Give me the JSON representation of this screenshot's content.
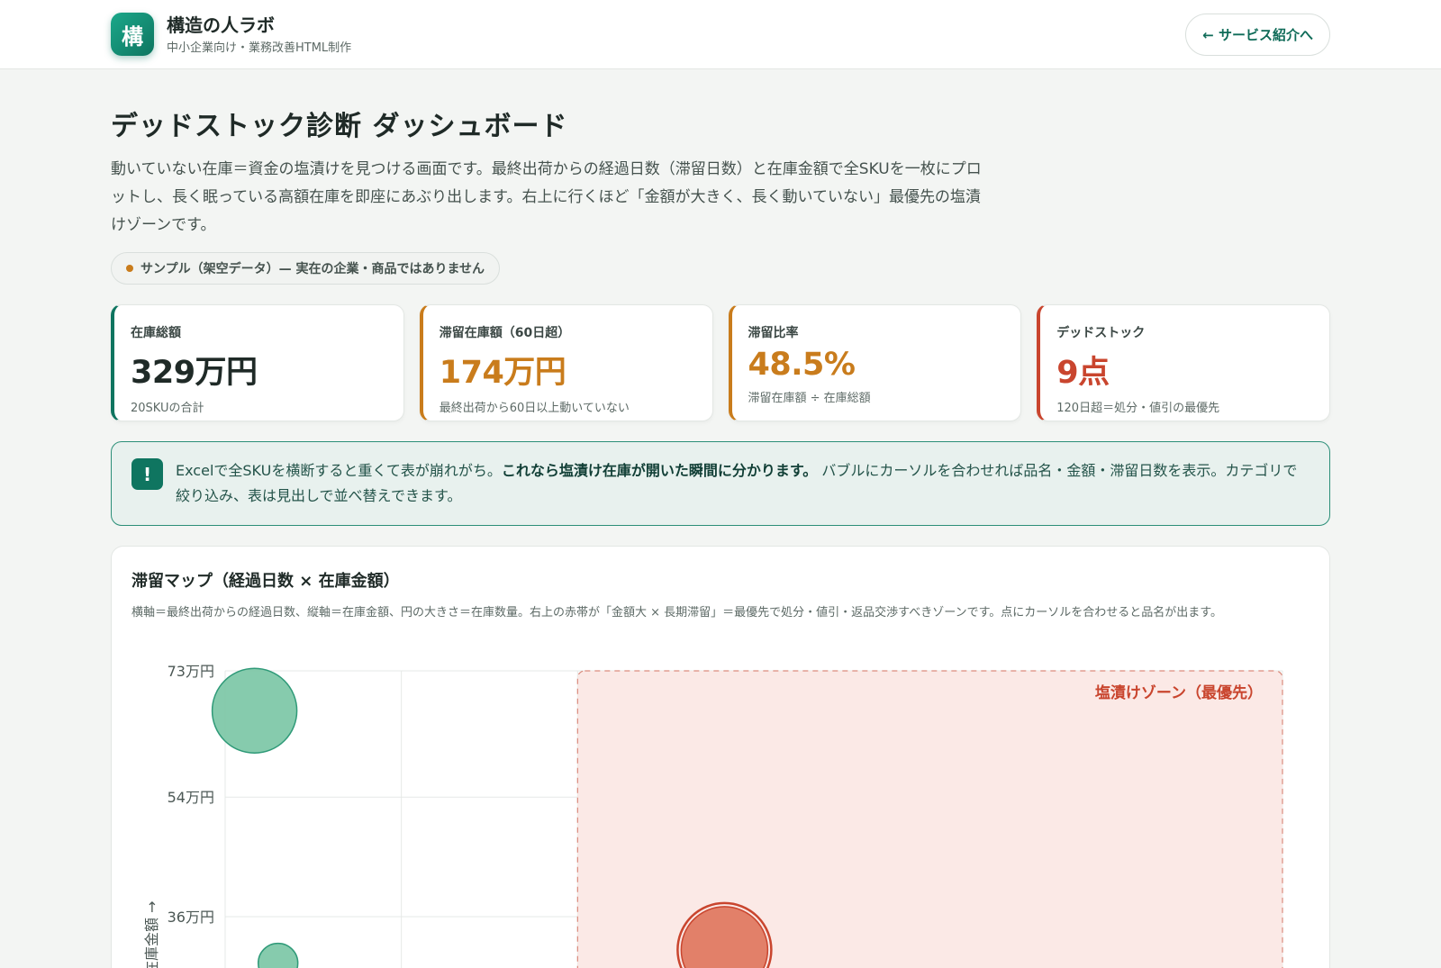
{
  "header": {
    "logo_char": "構",
    "brand_name": "構造の人ラボ",
    "brand_sub": "中小企業向け・業務改善HTML制作",
    "nav_button": "← サービス紹介へ"
  },
  "page": {
    "title": "デッドストック診断 ダッシュボード",
    "description": "動いていない在庫＝資金の塩漬けを見つける画面です。最終出荷からの経過日数（滞留日数）と在庫金額で全SKUを一枚にプロットし、長く眠っている高額在庫を即座にあぶり出します。右上に行くほど「金額が大きく、長く動いていない」最優先の塩漬けゾーンです。",
    "sample_badge": "サンプル（架空データ）— 実在の企業・商品ではありません"
  },
  "kpis": [
    {
      "label": "在庫総額",
      "value": "329万円",
      "sub": "20SKUの合計"
    },
    {
      "label": "滞留在庫額（60日超）",
      "value": "174万円",
      "sub": "最終出荷から60日以上動いていない"
    },
    {
      "label": "滞留比率",
      "value": "48.5%",
      "sub": "滞留在庫額 ÷ 在庫総額"
    },
    {
      "label": "デッドストック",
      "value": "9点",
      "sub": "120日超＝処分・値引の最優先"
    }
  ],
  "notice": {
    "icon": "!",
    "text_before": "Excelで全SKUを横断すると重くて表が崩れがち。",
    "text_bold": "これなら塩漬け在庫が開いた瞬間に分かります。",
    "text_after": " バブルにカーソルを合わせれば品名・金額・滞留日数を表示。カテゴリで絞り込み、表は見出しで並べ替えできます。"
  },
  "chart_card": {
    "title": "滞留マップ（経過日数 × 在庫金額）",
    "description": "横軸＝最終出荷からの経過日数、縦軸＝在庫金額、円の大きさ＝在庫数量。右上の赤帯が「金額大 × 長期滞留」＝最優先で処分・値引・返品交渉すべきゾーンです。点にカーソルを合わせると品名が出ます。"
  },
  "chart_data": {
    "type": "scatter",
    "ylabel": "在庫金額 →",
    "yticks": [
      "73万円",
      "54万円",
      "36万円"
    ],
    "ytick_values": [
      73,
      54,
      36
    ],
    "zone_label": "塩漬けゾーン（最優先）",
    "points": [
      {
        "x": 5,
        "y": 67,
        "r": 47,
        "color": "#7fc8a9"
      },
      {
        "x": 85,
        "y": 31,
        "r": 48,
        "color": "#e07a62"
      },
      {
        "x": 9,
        "y": 29,
        "r": 22,
        "color": "#7fc8a9"
      }
    ]
  },
  "colors": {
    "accent": "#0f7560",
    "warning": "#c97c1c",
    "danger": "#c9452e"
  }
}
